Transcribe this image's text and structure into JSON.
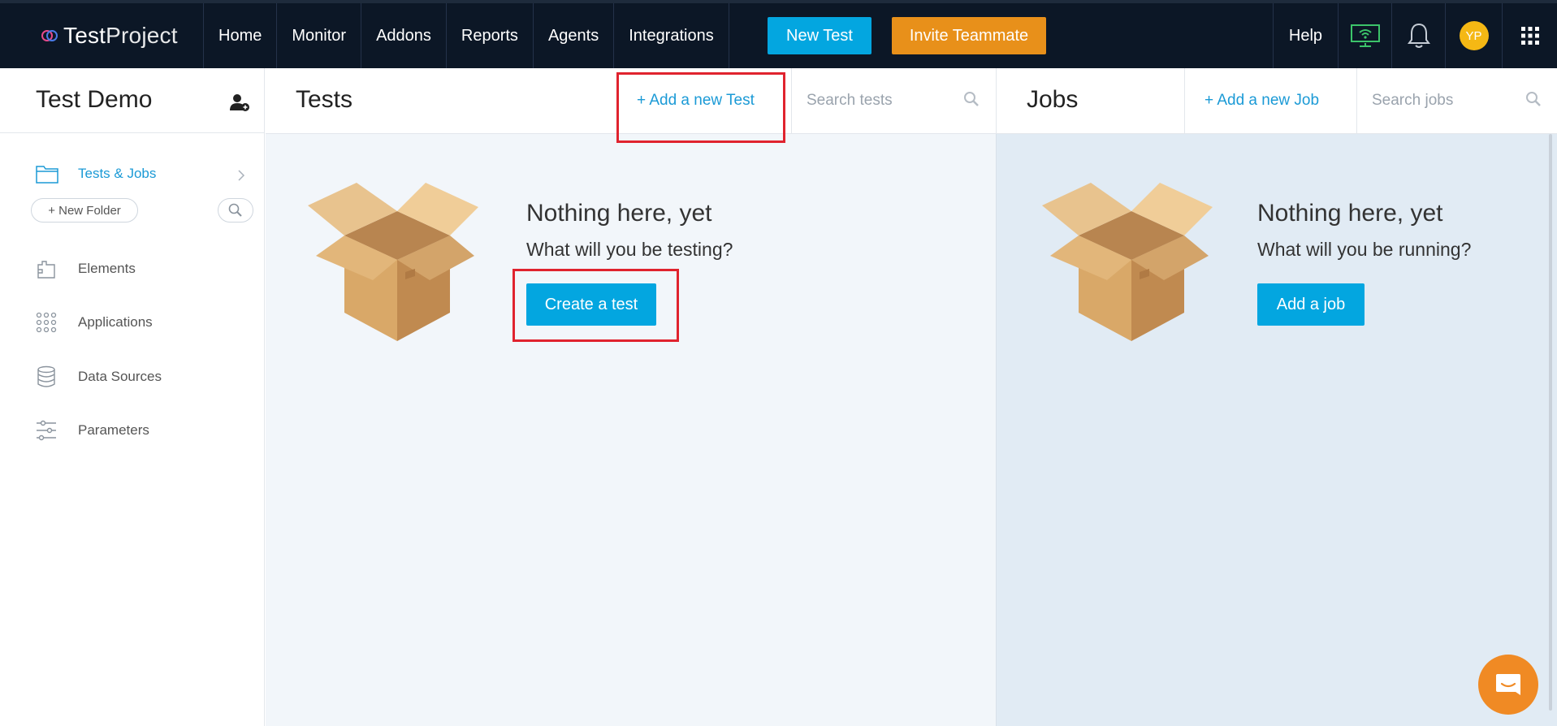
{
  "brand": {
    "name_bold": "Test",
    "name_light": "Project"
  },
  "nav": [
    "Home",
    "Monitor",
    "Addons",
    "Reports",
    "Agents",
    "Integrations"
  ],
  "buttons": {
    "new_test": "New Test",
    "invite": "Invite Teammate"
  },
  "top_right": {
    "help": "Help",
    "avatar_initials": "YP"
  },
  "sidebar": {
    "project_title": "Test Demo",
    "tests_jobs": "Tests & Jobs",
    "new_folder": "+ New Folder",
    "items": [
      "Elements",
      "Applications",
      "Data Sources",
      "Parameters"
    ]
  },
  "tests": {
    "title": "Tests",
    "add": "+ Add a new Test",
    "search_placeholder": "Search tests",
    "empty_title": "Nothing here, yet",
    "empty_sub": "What will you be testing?",
    "cta": "Create a test"
  },
  "jobs": {
    "title": "Jobs",
    "add": "+ Add a new Job",
    "search_placeholder": "Search jobs",
    "empty_title": "Nothing here, yet",
    "empty_sub": "What will you be running?",
    "cta": "Add a job"
  },
  "colors": {
    "primary": "#03a6e0",
    "invite": "#e8901a",
    "topbar": "#0c1726",
    "highlight": "#e0232e"
  }
}
